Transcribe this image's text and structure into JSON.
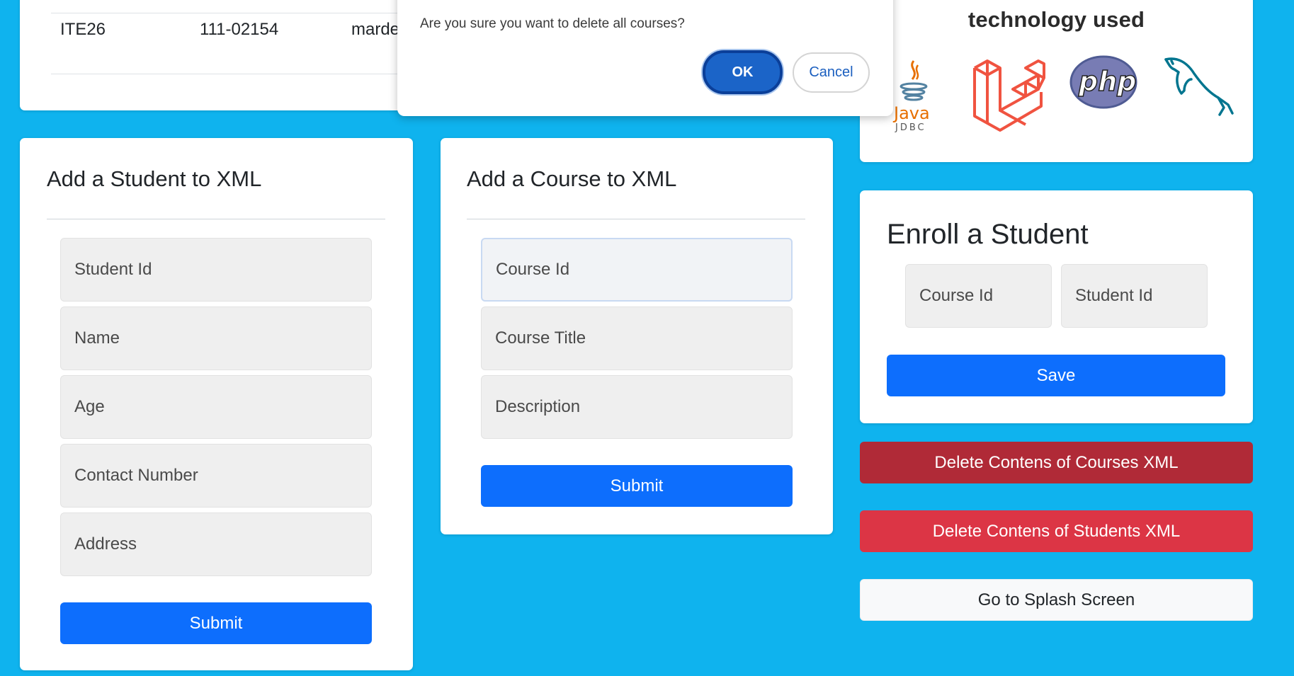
{
  "table": {
    "row": [
      "ITE26",
      "111-02154",
      "marde"
    ]
  },
  "dialog": {
    "message": "Are you sure you want to delete all courses?",
    "ok_label": "OK",
    "cancel_label": "Cancel"
  },
  "tech": {
    "title": "technology used",
    "logos": [
      "java-jdbc-logo",
      "laravel-logo",
      "php-logo",
      "mysql-dolphin-logo"
    ],
    "java_text": "Java",
    "jdbc_text": "JDBC",
    "php_text": "php"
  },
  "student_form": {
    "title": "Add a Student to XML",
    "fields": [
      "Student Id",
      "Name",
      "Age",
      "Contact Number",
      "Address"
    ],
    "submit_label": "Submit"
  },
  "course_form": {
    "title": "Add a Course to XML",
    "fields": [
      "Course Id",
      "Course Title",
      "Description"
    ],
    "submit_label": "Submit"
  },
  "enroll_form": {
    "title": "Enroll a Student",
    "fields": [
      "Course Id",
      "Student Id"
    ],
    "save_label": "Save"
  },
  "actions": {
    "delete_courses_label": "Delete Contens of Courses XML",
    "delete_students_label": "Delete Contens of Students XML",
    "splash_label": "Go to Splash Screen"
  },
  "colors": {
    "background": "#0fb3ee",
    "primary": "#0d6efd",
    "danger_dark": "#b02a37",
    "danger": "#dc3545"
  }
}
